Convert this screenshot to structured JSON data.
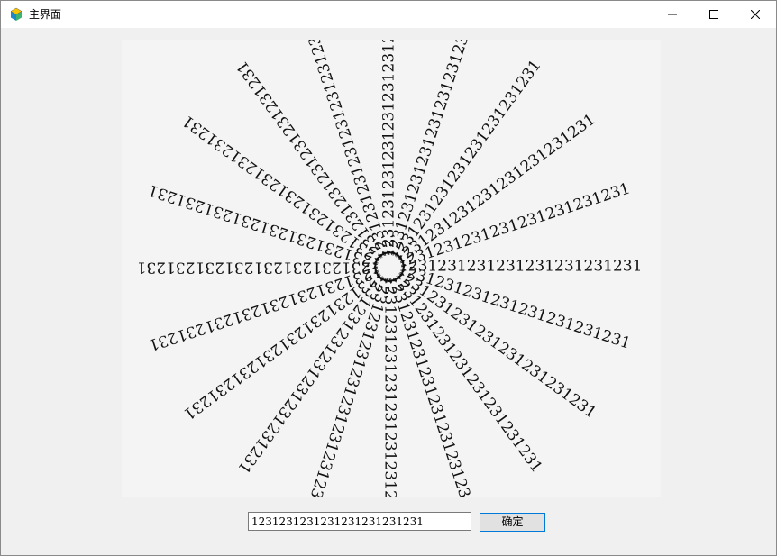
{
  "window": {
    "title": "主界面",
    "icon": "cube-app-icon",
    "controls": {
      "minimize": "minimize-icon",
      "maximize": "maximize-icon",
      "close": "close-icon"
    }
  },
  "canvas": {
    "spiral_text": "1231231231231231231231231",
    "ray_count": 20,
    "colors": {
      "background": "#f4f4f4",
      "text": "#111111"
    }
  },
  "form": {
    "input_value": "1231231231231231231231231",
    "confirm_label": "确定"
  },
  "colors": {
    "window_bg": "#f0f0f0",
    "titlebar_bg": "#ffffff",
    "button_border": "#0078d7",
    "button_bg": "#e1e1e1"
  }
}
